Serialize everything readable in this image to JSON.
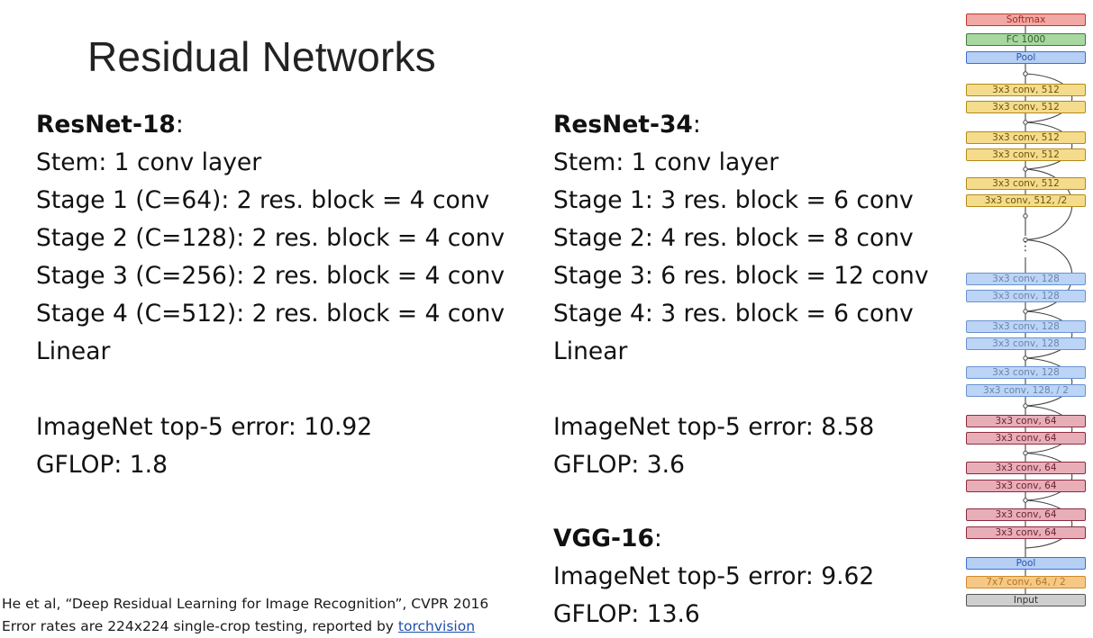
{
  "slide": {
    "title": "Residual Networks"
  },
  "resnet18": {
    "name": "ResNet-18",
    "name_suffix": ":",
    "lines": [
      "Stem: 1 conv layer",
      "Stage 1 (C=64): 2 res. block = 4 conv",
      "Stage 2 (C=128): 2 res. block = 4 conv",
      "Stage 3 (C=256): 2 res. block = 4 conv",
      "Stage 4 (C=512): 2 res. block = 4 conv",
      "Linear"
    ],
    "error": "ImageNet top-5 error: 10.92",
    "gflop": "GFLOP: 1.8"
  },
  "resnet34": {
    "name": "ResNet-34",
    "name_suffix": ":",
    "lines": [
      "Stem: 1 conv layer",
      "Stage 1: 3 res. block = 6 conv",
      "Stage 2: 4 res. block = 8 conv",
      "Stage 3: 6 res. block = 12 conv",
      "Stage 4: 3 res. block = 6 conv",
      "Linear"
    ],
    "error": "ImageNet top-5 error: 8.58",
    "gflop": "GFLOP: 3.6"
  },
  "vgg16": {
    "name": "VGG-16",
    "name_suffix": ":",
    "error": "ImageNet top-5 error: 9.62",
    "gflop": "GFLOP: 13.6"
  },
  "citation": {
    "line1": "He et al, “Deep Residual Learning for Image Recognition”, CVPR 2016",
    "line2_prefix": "Error rates are 224x224 single-crop testing, reported by ",
    "link": "torchvision"
  },
  "network": {
    "ellipsis": "⋮",
    "layers": [
      {
        "label": "Softmax",
        "kind": "softmax"
      },
      {
        "label": "FC 1000",
        "kind": "fc"
      },
      {
        "label": "Pool",
        "kind": "pool"
      },
      {
        "label": "3x3 conv, 512",
        "kind": "y"
      },
      {
        "label": "3x3 conv, 512",
        "kind": "y"
      },
      {
        "label": "3x3 conv, 512",
        "kind": "y"
      },
      {
        "label": "3x3 conv, 512",
        "kind": "y"
      },
      {
        "label": "3x3 conv, 512",
        "kind": "y"
      },
      {
        "label": "3x3 conv, 512, /2",
        "kind": "y"
      },
      {
        "label": "3x3 conv, 128",
        "kind": "b"
      },
      {
        "label": "3x3 conv, 128",
        "kind": "b"
      },
      {
        "label": "3x3 conv, 128",
        "kind": "b"
      },
      {
        "label": "3x3 conv, 128",
        "kind": "b"
      },
      {
        "label": "3x3 conv, 128",
        "kind": "b"
      },
      {
        "label": "3x3 conv, 128, / 2",
        "kind": "b"
      },
      {
        "label": "3x3 conv, 64",
        "kind": "r"
      },
      {
        "label": "3x3 conv, 64",
        "kind": "r"
      },
      {
        "label": "3x3 conv, 64",
        "kind": "r"
      },
      {
        "label": "3x3 conv, 64",
        "kind": "r"
      },
      {
        "label": "3x3 conv, 64",
        "kind": "r"
      },
      {
        "label": "3x3 conv, 64",
        "kind": "r"
      },
      {
        "label": "Pool",
        "kind": "pool"
      },
      {
        "label": "7x7 conv, 64, / 2",
        "kind": "o"
      },
      {
        "label": "Input",
        "kind": "in"
      }
    ]
  }
}
